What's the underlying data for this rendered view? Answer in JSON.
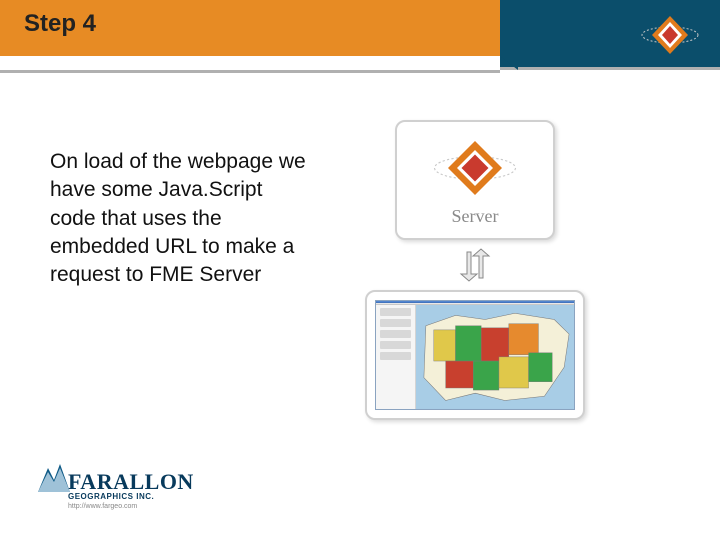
{
  "header": {
    "title": "Step 4"
  },
  "body": {
    "text": "On load of the webpage we have some Java.Script code that uses the embedded URL to make a request to FME Server"
  },
  "diagram": {
    "server_label": "Server"
  },
  "footer": {
    "brand": "FARALLON",
    "sub": "GEOGRAPHICS INC.",
    "url": "http://www.fargeo.com"
  }
}
